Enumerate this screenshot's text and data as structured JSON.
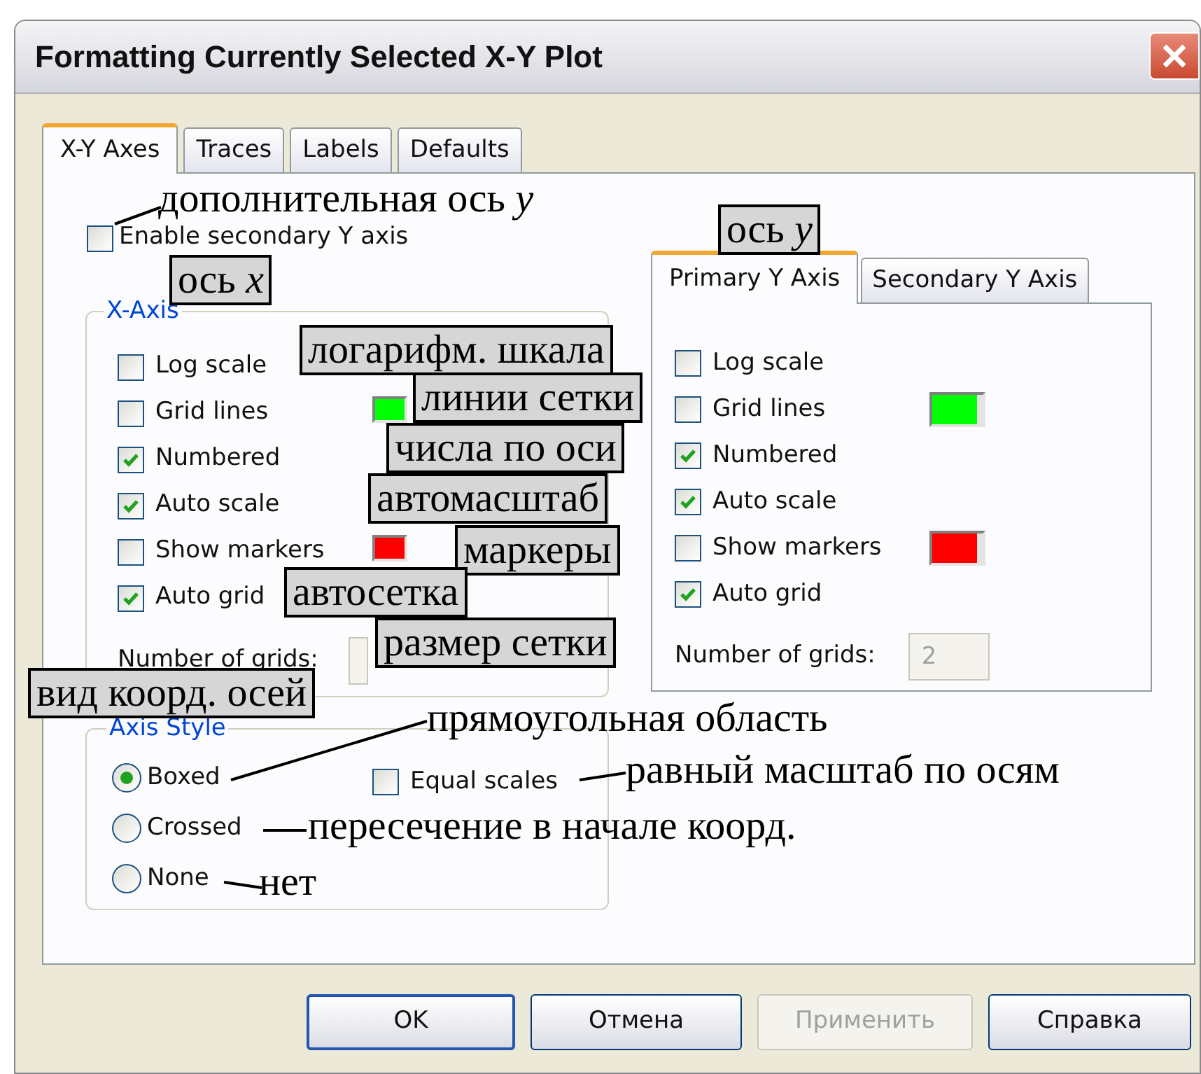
{
  "window": {
    "title": "Formatting Currently Selected X-Y Plot"
  },
  "tabs": [
    {
      "label": "X-Y Axes",
      "selected": true
    },
    {
      "label": "Traces",
      "selected": false
    },
    {
      "label": "Labels",
      "selected": false
    },
    {
      "label": "Defaults",
      "selected": false
    }
  ],
  "secondary_axis": {
    "label": "Enable secondary Y axis",
    "checked": false
  },
  "x_axis": {
    "legend": "X-Axis",
    "options": [
      {
        "label": "Log scale",
        "checked": false
      },
      {
        "label": "Grid lines",
        "checked": false,
        "color": "#00ff00"
      },
      {
        "label": "Numbered",
        "checked": true
      },
      {
        "label": "Auto scale",
        "checked": true
      },
      {
        "label": "Show markers",
        "checked": false,
        "color": "#ff0000"
      },
      {
        "label": "Auto grid",
        "checked": true
      }
    ],
    "grids_label": "Number of grids:"
  },
  "y_axis": {
    "tabs": [
      {
        "label": "Primary Y Axis",
        "selected": true
      },
      {
        "label": "Secondary Y Axis",
        "selected": false
      }
    ],
    "options": [
      {
        "label": "Log scale",
        "checked": false
      },
      {
        "label": "Grid lines",
        "checked": false,
        "color": "#00ff00"
      },
      {
        "label": "Numbered",
        "checked": true
      },
      {
        "label": "Auto scale",
        "checked": true
      },
      {
        "label": "Show markers",
        "checked": false,
        "color": "#ff0000"
      },
      {
        "label": "Auto grid",
        "checked": true
      }
    ],
    "grids_label": "Number of grids:",
    "grids_value": "2"
  },
  "axis_style": {
    "legend": "Axis Style",
    "options": [
      {
        "label": "Boxed",
        "selected": true
      },
      {
        "label": "Crossed",
        "selected": false
      },
      {
        "label": "None",
        "selected": false
      }
    ],
    "equal_scales": {
      "label": "Equal scales",
      "checked": false
    }
  },
  "buttons": [
    {
      "label": "OK",
      "default": true,
      "disabled": false
    },
    {
      "label": "Отмена",
      "default": false,
      "disabled": false
    },
    {
      "label": "Применить",
      "default": false,
      "disabled": true
    },
    {
      "label": "Справка",
      "default": false,
      "disabled": false
    }
  ],
  "annotations": [
    {
      "text": "дополнительная ось *y*",
      "kind": "plain"
    },
    {
      "text": "ось *y*",
      "kind": "boxed"
    },
    {
      "text": "ось *x*",
      "kind": "boxed"
    },
    {
      "text": "логарифм. шкала",
      "kind": "boxed"
    },
    {
      "text": "линии сетки",
      "kind": "boxed"
    },
    {
      "text": "числа по оси",
      "kind": "boxed"
    },
    {
      "text": "автомасштаб",
      "kind": "boxed"
    },
    {
      "text": "маркеры",
      "kind": "boxed"
    },
    {
      "text": "автосетка",
      "kind": "boxed"
    },
    {
      "text": "размер сетки",
      "kind": "boxed"
    },
    {
      "text": "вид коорд. осей",
      "kind": "boxed"
    },
    {
      "text": "прямоугольная область",
      "kind": "plain"
    },
    {
      "text": "равный масштаб по осям",
      "kind": "plain"
    },
    {
      "text": "пересечение в начале коорд.",
      "kind": "plain"
    },
    {
      "text": "нет",
      "kind": "plain"
    }
  ]
}
